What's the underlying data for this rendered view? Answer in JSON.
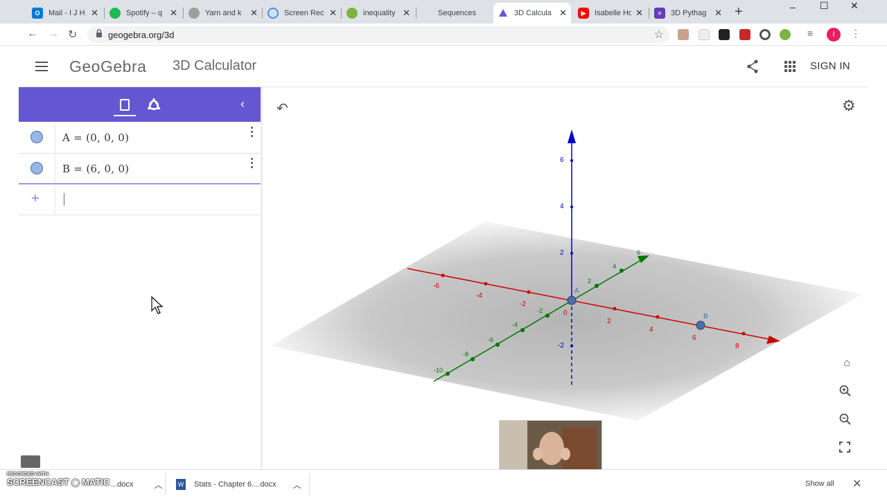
{
  "browser": {
    "tabs": [
      {
        "title": "Mail - I J H",
        "color": "#0078d4",
        "glyph": "O"
      },
      {
        "title": "Spotify – q",
        "color": "#1db954",
        "glyph": ""
      },
      {
        "title": "Yarn and k",
        "color": "#888888",
        "glyph": ""
      },
      {
        "title": "Screen Rec",
        "color": "#4a90d9",
        "glyph": ""
      },
      {
        "title": "inequality",
        "color": "#7cb342",
        "glyph": ""
      },
      {
        "title": "Sequences",
        "color": "#ffffff",
        "glyph": ""
      },
      {
        "title": "3D Calcula",
        "color": "#6557d2",
        "glyph": ""
      },
      {
        "title": "Isabelle Ho",
        "color": "#ff0000",
        "glyph": "▶"
      },
      {
        "title": "3D Pythag",
        "color": "#673ab7",
        "glyph": ""
      }
    ],
    "url": "geogebra.org/3d"
  },
  "header": {
    "logo": "GeoGebra",
    "title": "3D Calculator",
    "signin": "SIGN IN"
  },
  "algebra": {
    "rows": [
      {
        "expr": "A = (0, 0, 0)"
      },
      {
        "expr": "B = (6, 0, 0)"
      }
    ],
    "input_plus": "+"
  },
  "graphics": {
    "point_labels": [
      "A",
      "B"
    ],
    "x_ticks": [
      "-6",
      "-4",
      "-2",
      "0",
      "2",
      "4",
      "6",
      "8"
    ],
    "y_ticks": [
      "-10",
      "-8",
      "-6",
      "-4",
      "-2",
      "2",
      "4",
      "6"
    ],
    "z_ticks": [
      "2",
      "4",
      "6",
      "-2"
    ],
    "colors": {
      "x_axis": "#cc0000",
      "y_axis": "#007700",
      "z_axis": "#0000cc",
      "point": "#4a6fa5"
    }
  },
  "downloads": {
    "items": [
      "...docx",
      "Stats - Chapter 6....docx"
    ],
    "show_all": "Show all"
  },
  "watermark": {
    "line1": "RECORDED WITH",
    "line2": "SCREENCAST",
    "line3": "MATIC"
  }
}
